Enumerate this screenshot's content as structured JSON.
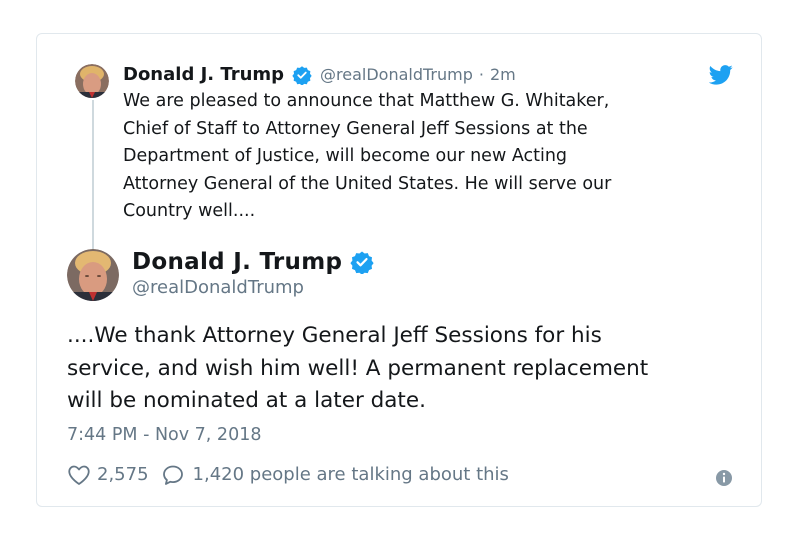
{
  "colors": {
    "accent": "#1da1f2",
    "text": "#14171a",
    "muted": "#657786",
    "border": "#e1e8ed"
  },
  "parent_tweet": {
    "author_name": "Donald J. Trump",
    "handle": "@realDonaldTrump",
    "separator": "·",
    "time": "2m",
    "text": "We are pleased to announce that Matthew G. Whitaker,\nChief of Staff to Attorney General Jeff Sessions at the\nDepartment of Justice, will become our new Acting\nAttorney General of the United States. He will serve our\nCountry well....",
    "avatar_icon": "avatar-photo",
    "verified_icon": "verified-badge-icon"
  },
  "main_tweet": {
    "author_name": "Donald J. Trump",
    "handle": "@realDonaldTrump",
    "text": "....We thank Attorney General Jeff Sessions for his\nservice, and wish him well! A permanent replacement\nwill be nominated at a later date.",
    "timestamp": "7:44 PM - Nov 7, 2018",
    "likes": "2,575",
    "replies_text": "1,420 people are talking about this",
    "avatar_icon": "avatar-photo",
    "verified_icon": "verified-badge-icon"
  },
  "icons": {
    "brand": "twitter-bird-icon",
    "like": "heart-icon",
    "reply": "speech-bubble-icon",
    "info": "info-icon"
  }
}
